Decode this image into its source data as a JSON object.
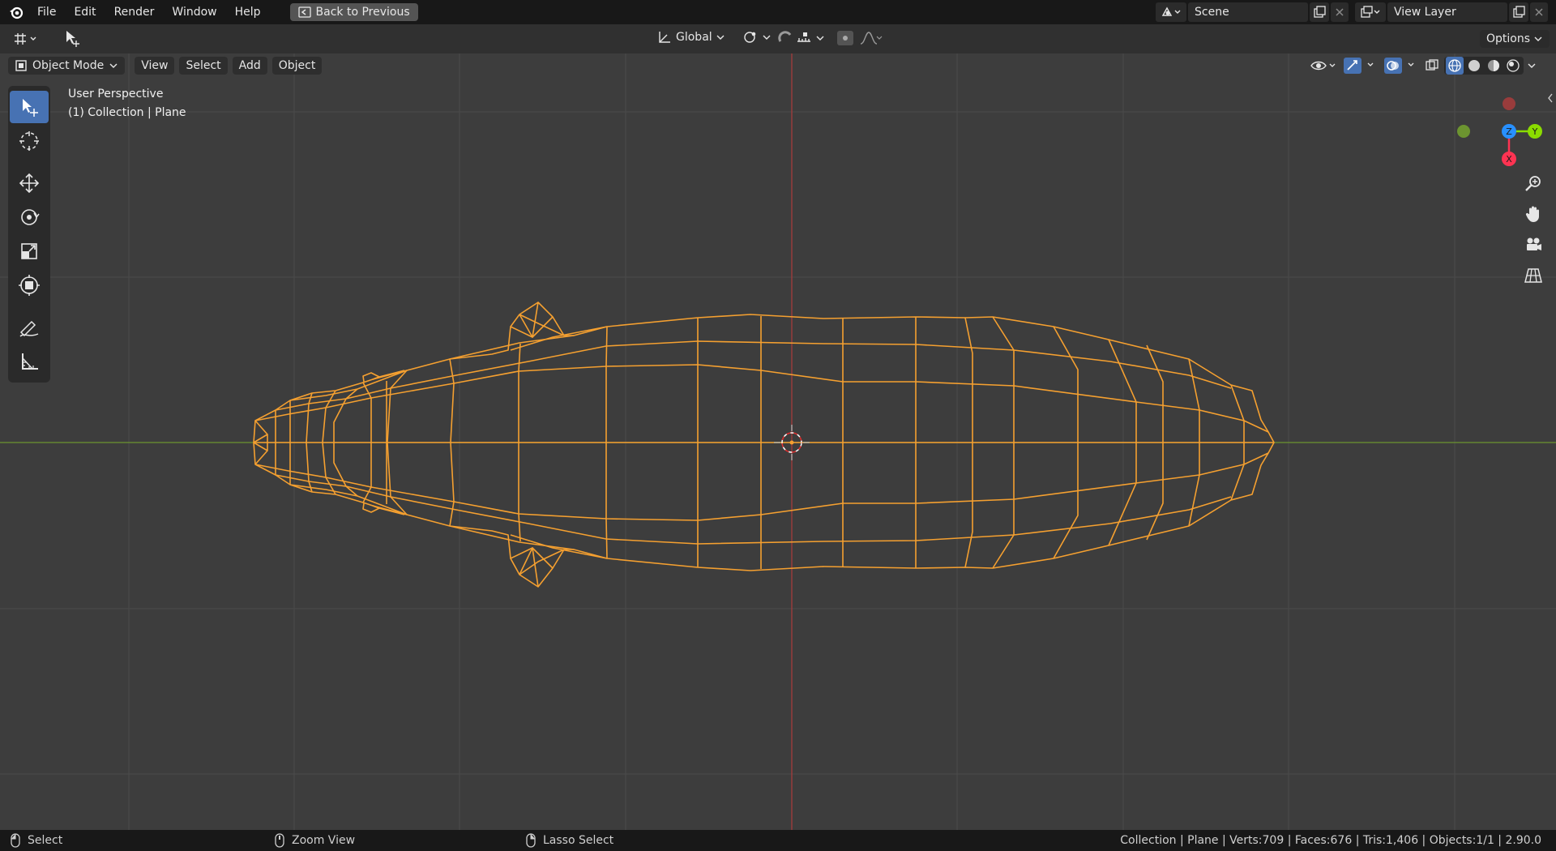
{
  "menubar": {
    "items": [
      "File",
      "Edit",
      "Render",
      "Window",
      "Help"
    ],
    "back_label": "Back to Previous",
    "scene_value": "Scene",
    "view_layer_value": "View Layer"
  },
  "header": {
    "transform_orientation": "Global",
    "options_label": "Options"
  },
  "viewport_header": {
    "mode_label": "Object Mode",
    "menu_view": "View",
    "menu_select": "Select",
    "menu_add": "Add",
    "menu_object": "Object"
  },
  "overlay": {
    "view_name": "User Perspective",
    "context": "(1) Collection | Plane"
  },
  "gizmo": {
    "z_label": "Z",
    "y_label": "Y",
    "x_label": "X",
    "colors": {
      "x": "#ff3352",
      "y": "#8bdc00",
      "z": "#2890ff"
    }
  },
  "statusbar": {
    "left_action": "Select",
    "middle_action": "Zoom View",
    "right_action": "Lasso Select",
    "stats": "Collection | Plane | Verts:709 | Faces:676 | Tris:1,406 | Objects:1/1 | 2.90.0"
  },
  "colors": {
    "accent": "#4772b3",
    "wire_selected": "#f5a030",
    "axis_x_line": "#a33c3c",
    "axis_y_line": "#6c9430"
  }
}
